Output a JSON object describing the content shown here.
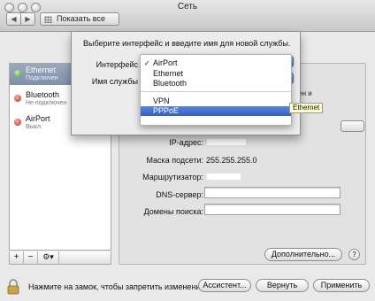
{
  "window": {
    "title": "Сеть"
  },
  "toolbar": {
    "back_symbol": "◀",
    "forward_symbol": "▶",
    "show_all_label": "Показать все"
  },
  "services": [
    {
      "name": "Ethernet",
      "status": "Подключен",
      "status_color": "#3aa21b",
      "selected": true
    },
    {
      "name": "Bluetooth",
      "status": "Не подключен",
      "status_color": "#d01b10",
      "selected": false
    },
    {
      "name": "AirPort",
      "status": "Выкл.",
      "status_color": "#d01b10",
      "selected": false
    }
  ],
  "list_tools": {
    "add": "+",
    "remove": "−",
    "gear": "⚙▾"
  },
  "detail": {
    "partial_text": "вен и",
    "ip_label": "IP-адрес:",
    "subnet_label": "Маска подсети:",
    "subnet_value": "255.255.255.0",
    "router_label": "Маршрутизатор:",
    "dns_label": "DNS-сервер:",
    "search_domains_label": "Домены поиска:",
    "advanced_button": "Дополнительно...",
    "help_button": "?"
  },
  "bottom": {
    "lock_text": "Нажмите на замок, чтобы запретить изменения.",
    "assistant_button": "Ассистент...",
    "revert_button": "Вернуть",
    "apply_button": "Применить"
  },
  "sheet": {
    "prompt": "Выберите интерфейс и введите имя для новой службы.",
    "interface_label": "Интерфейс",
    "service_name_label": "Имя службы"
  },
  "dropdown": {
    "items_group1": [
      {
        "label": "AirPort",
        "checked": true,
        "check_mark": "✓"
      },
      {
        "label": "Ethernet",
        "checked": false
      },
      {
        "label": "Bluetooth",
        "checked": false
      }
    ],
    "items_group2": [
      {
        "label": "VPN",
        "highlighted": false
      },
      {
        "label": "PPPoE",
        "highlighted": true
      }
    ],
    "highlight_color": "#2f5fc8"
  },
  "tooltip": {
    "text": "Ethernet"
  }
}
